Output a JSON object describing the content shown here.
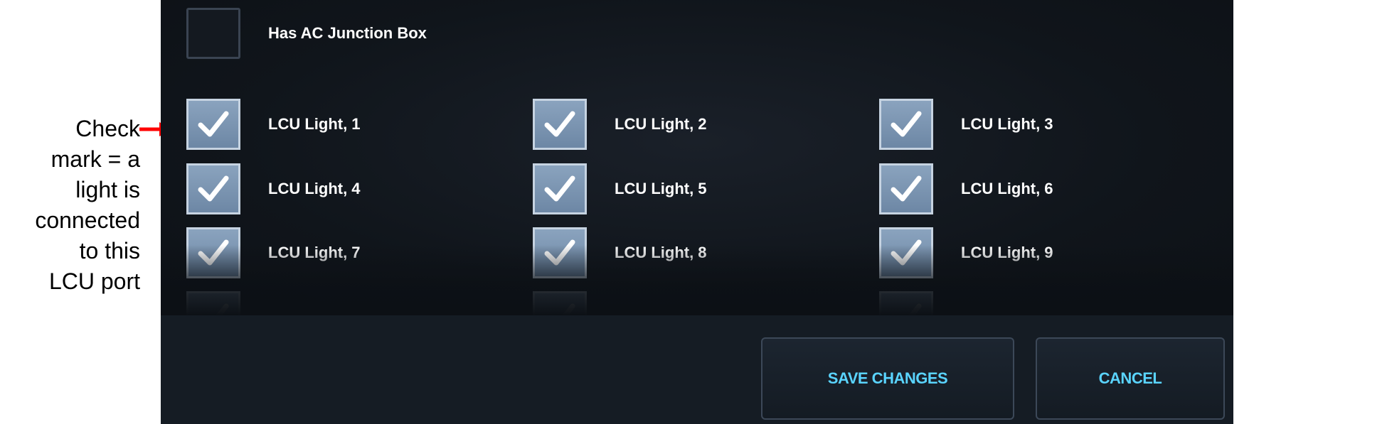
{
  "annotation": {
    "lines": [
      "Check",
      "mark = a",
      "light is",
      "connected",
      "to this",
      "LCU port"
    ],
    "arrow_color": "#ff0000"
  },
  "junction": {
    "label": "Has AC Junction Box",
    "checked": false
  },
  "lights": [
    {
      "label": "LCU Light, 1",
      "checked": true
    },
    {
      "label": "LCU Light, 2",
      "checked": true
    },
    {
      "label": "LCU Light, 3",
      "checked": true
    },
    {
      "label": "LCU Light, 4",
      "checked": true
    },
    {
      "label": "LCU Light, 5",
      "checked": true
    },
    {
      "label": "LCU Light, 6",
      "checked": true
    },
    {
      "label": "LCU Light, 7",
      "checked": true
    },
    {
      "label": "LCU Light, 8",
      "checked": true
    },
    {
      "label": "LCU Light, 9",
      "checked": true
    }
  ],
  "buttons": {
    "save": "SAVE CHANGES",
    "cancel": "CANCEL"
  },
  "colors": {
    "accent": "#5ad4ff",
    "panel_bg": "#0f1319",
    "checkbox_fill": "#7b95b2"
  },
  "icons": {
    "checkmark": "check-icon",
    "arrow": "arrow-right-icon"
  }
}
